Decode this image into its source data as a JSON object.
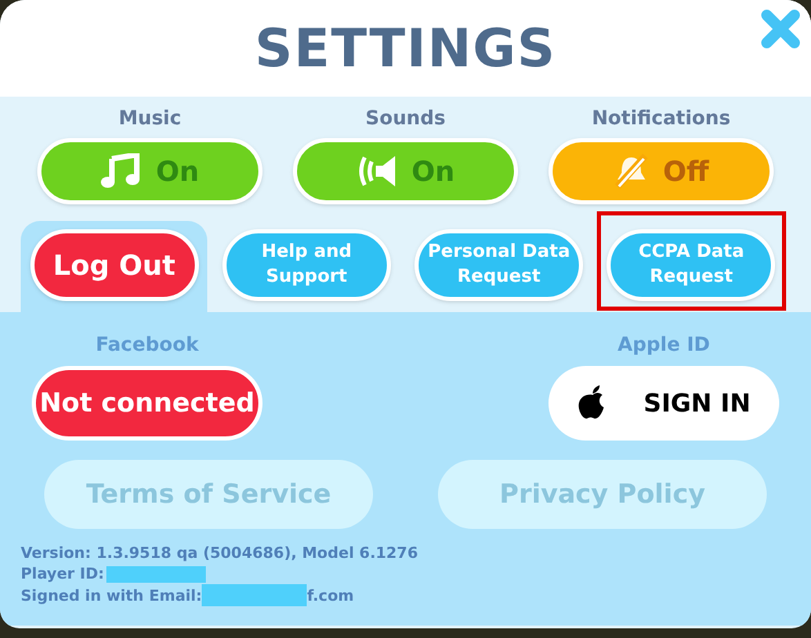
{
  "title": "SETTINGS",
  "toggles": [
    {
      "kind": "music",
      "label": "Music",
      "state_text": "On",
      "on": true
    },
    {
      "kind": "sounds",
      "label": "Sounds",
      "state_text": "On",
      "on": true
    },
    {
      "kind": "notifications",
      "label": "Notifications",
      "state_text": "Off",
      "on": false
    }
  ],
  "tabs": [
    {
      "label": "Log Out",
      "kind": "danger",
      "selected": true,
      "highlighted": false
    },
    {
      "label": "Help and Support",
      "kind": "info",
      "selected": false,
      "highlighted": false
    },
    {
      "label": "Personal Data Request",
      "kind": "info",
      "selected": false,
      "highlighted": false
    },
    {
      "label": "CCPA Data Request",
      "kind": "info",
      "selected": false,
      "highlighted": true
    }
  ],
  "accounts": [
    {
      "kind": "facebook",
      "label": "Facebook",
      "button": "Not connected"
    },
    {
      "kind": "apple",
      "label": "Apple ID",
      "button": "SIGN IN"
    }
  ],
  "links": [
    {
      "label": "Terms of Service",
      "disabled": true
    },
    {
      "label": "Privacy Policy",
      "disabled": true
    }
  ],
  "footer": {
    "version": "Version: 1.3.9518 qa (5004686), Model 6.1276",
    "player_id_label": "Player ID:",
    "email_label": "Signed in with Email:",
    "email_suffix": "f.com"
  }
}
